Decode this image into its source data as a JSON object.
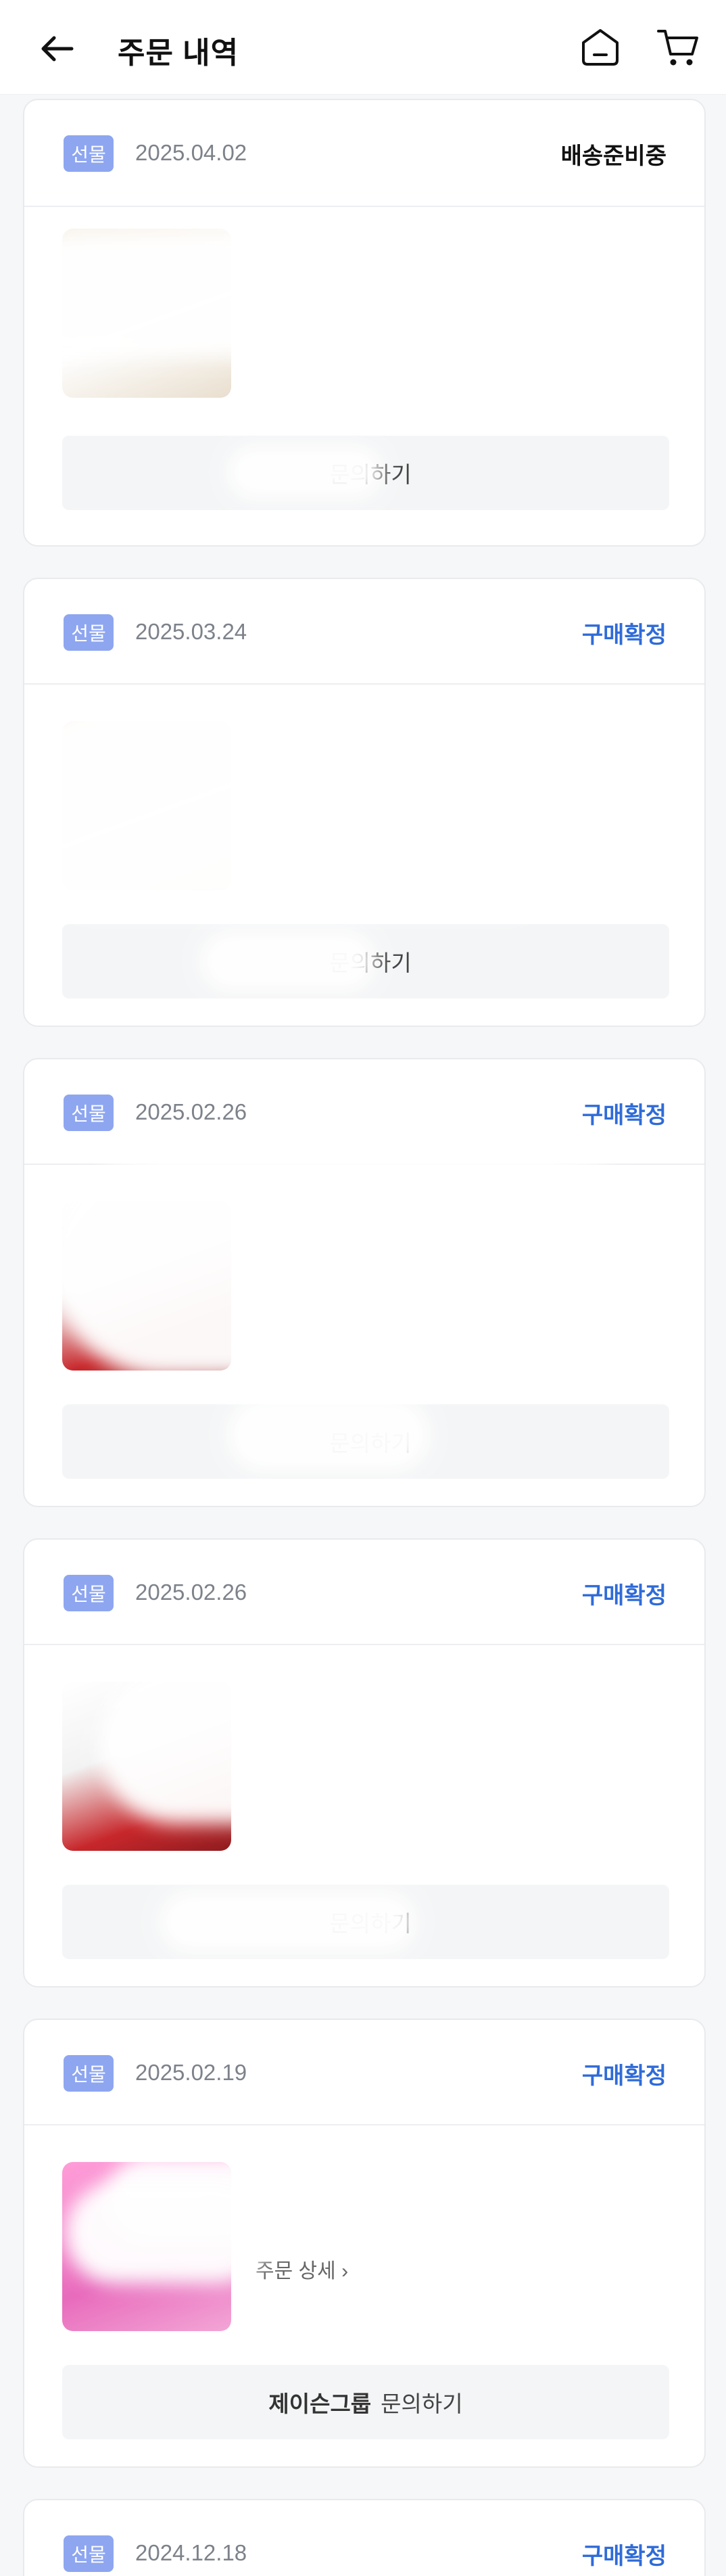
{
  "header": {
    "title": "주문 내역",
    "icons": {
      "back": "arrow-left-icon",
      "home": "home-icon",
      "cart": "cart-icon"
    }
  },
  "orders": [
    {
      "badge": "선물",
      "date": "2025.04.02",
      "status": "배송준비중",
      "status_dark": true,
      "inquiry": "문의하기",
      "seller": "",
      "detail": "",
      "product_name": "",
      "product_sub": ""
    },
    {
      "badge": "선물",
      "date": "2025.03.24",
      "status": "구매확정",
      "status_dark": false,
      "inquiry": "문의하기",
      "seller": "",
      "detail": "",
      "product_name": "",
      "product_sub": ""
    },
    {
      "badge": "선물",
      "date": "2025.02.26",
      "status": "구매확정",
      "status_dark": false,
      "inquiry": "문의하기",
      "seller": "",
      "detail": "",
      "product_name": "",
      "product_sub": ""
    },
    {
      "badge": "선물",
      "date": "2025.02.26",
      "status": "구매확정",
      "status_dark": false,
      "inquiry": "문의하기",
      "seller": "",
      "detail": "",
      "product_name": "",
      "product_sub": ""
    },
    {
      "badge": "선물",
      "date": "2025.02.19",
      "status": "구매확정",
      "status_dark": false,
      "inquiry": "문의하기",
      "seller": "제이슨그룹",
      "detail": "주문 상세 ›",
      "product_name": "",
      "product_sub": ""
    },
    {
      "badge": "선물",
      "date": "2024.12.18",
      "status": "구매확정",
      "status_dark": false
    }
  ],
  "colors": {
    "accent": "#2f6bd8",
    "badge": "#8ea6f0",
    "background": "#f6f7f8"
  }
}
